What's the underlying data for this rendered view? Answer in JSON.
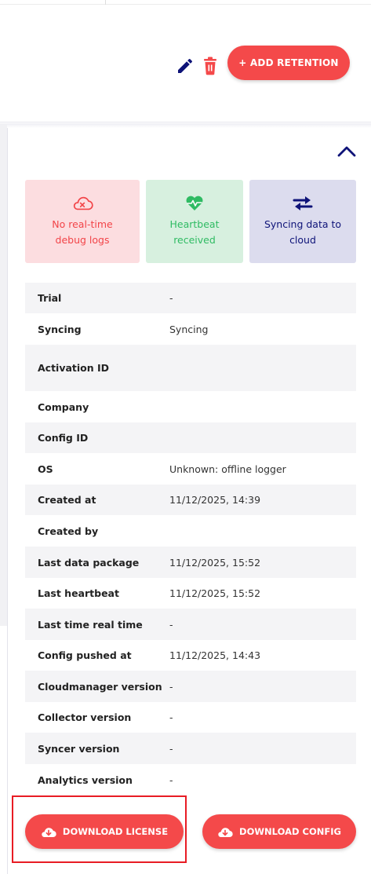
{
  "toolbar": {
    "add_retention_label": "+ ADD RETENTION",
    "edit_icon": "pencil-icon",
    "delete_icon": "trash-icon"
  },
  "panel": {
    "collapse_icon": "chevron-up-icon"
  },
  "status_cards": [
    {
      "icon": "cloud-x-icon",
      "line1": "No real-time",
      "line2": "debug logs",
      "color": "#f24448",
      "background": "#fcdde0"
    },
    {
      "icon": "heartbeat-icon",
      "line1": "Heartbeat",
      "line2": "received",
      "color": "#2fbb63",
      "background": "#d7f0df"
    },
    {
      "icon": "swap-arrows-icon",
      "line1": "Syncing data to",
      "line2": "cloud",
      "color": "#0e1378",
      "background": "#dcdcee"
    }
  ],
  "details": [
    {
      "label": "Trial",
      "value": "-"
    },
    {
      "label": "Syncing",
      "value": "Syncing"
    },
    {
      "label": "Activation ID",
      "value": ""
    },
    {
      "label": "Company",
      "value": ""
    },
    {
      "label": "Config ID",
      "value": ""
    },
    {
      "label": "OS",
      "value": "Unknown: offline logger"
    },
    {
      "label": "Created at",
      "value": "11/12/2025, 14:39"
    },
    {
      "label": "Created by",
      "value": ""
    },
    {
      "label": "Last data package",
      "value": "11/12/2025, 15:52"
    },
    {
      "label": "Last heartbeat",
      "value": "11/12/2025, 15:52"
    },
    {
      "label": "Last time real time",
      "value": "-"
    },
    {
      "label": "Config pushed at",
      "value": "11/12/2025, 14:43"
    },
    {
      "label": "Cloudmanager version",
      "value": "-"
    },
    {
      "label": "Collector version",
      "value": "-"
    },
    {
      "label": "Syncer version",
      "value": "-"
    },
    {
      "label": "Analytics version",
      "value": "-"
    }
  ],
  "actions": {
    "download_license_label": "DOWNLOAD LICENSE",
    "download_config_label": "DOWNLOAD CONFIG",
    "download_icon": "cloud-download-icon"
  },
  "colors": {
    "accent": "#f4494a",
    "navy": "#0e1378",
    "highlight": "#e81c24"
  }
}
